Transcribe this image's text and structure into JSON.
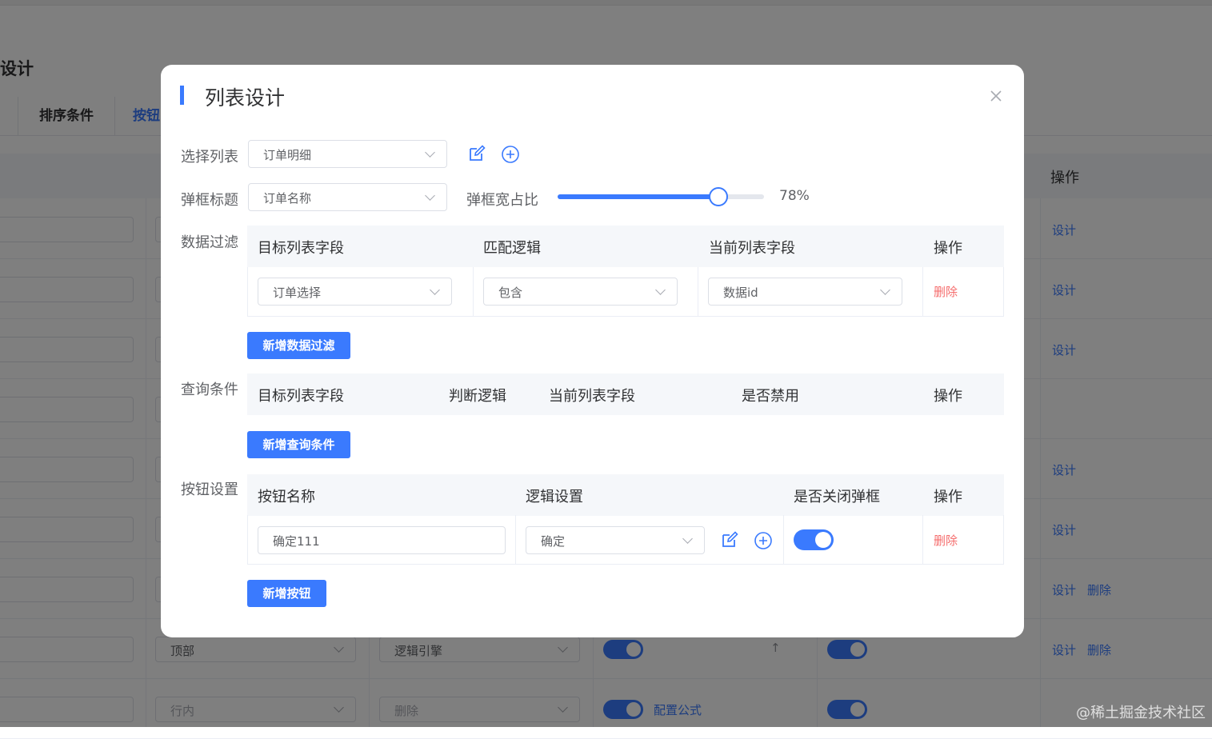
{
  "background": {
    "page_title": "设计",
    "tabs": [
      {
        "label": "排序条件"
      },
      {
        "label": "按钮"
      }
    ],
    "operation_header": "操作",
    "row_actions": [
      {
        "design": "设计",
        "delete": ""
      },
      {
        "design": "设计",
        "delete": ""
      },
      {
        "design": "设计",
        "delete": ""
      },
      {
        "design": "",
        "delete": ""
      },
      {
        "design": "设计",
        "delete": ""
      },
      {
        "design": "设计",
        "delete": ""
      },
      {
        "design": "设计",
        "delete": "删除"
      },
      {
        "design": "设计",
        "delete": "删除"
      }
    ],
    "row7": {
      "position": "顶部",
      "engine": "逻辑引擎",
      "arrow": "↑"
    },
    "row8": {
      "position": "行内",
      "engine": "删除",
      "formula": "配置公式"
    },
    "watermark": "@稀土掘金技术社区"
  },
  "dialog": {
    "title": "列表设计",
    "select_list": {
      "label": "选择列表",
      "value": "订单明细"
    },
    "dialog_title_field": {
      "label": "弹框标题",
      "value": "订单名称"
    },
    "width_ratio": {
      "label": "弹框宽占比",
      "value_text": "78%",
      "value": 0.78
    },
    "data_filter": {
      "label": "数据过滤",
      "headers": [
        "目标列表字段",
        "匹配逻辑",
        "当前列表字段",
        "操作"
      ],
      "rows": [
        {
          "target": "订单选择",
          "logic": "包含",
          "current": "数据id",
          "action": "删除"
        }
      ],
      "add_button": "新增数据过滤"
    },
    "query_conditions": {
      "label": "查询条件",
      "headers": [
        "目标列表字段",
        "判断逻辑",
        "当前列表字段",
        "是否禁用",
        "操作"
      ],
      "add_button": "新增查询条件"
    },
    "button_settings": {
      "label": "按钮设置",
      "headers": [
        "按钮名称",
        "逻辑设置",
        "是否关闭弹框",
        "操作"
      ],
      "rows": [
        {
          "name": "确定111",
          "logic": "确定",
          "close_dialog": true,
          "action": "删除"
        }
      ],
      "add_button": "新增按钮"
    }
  },
  "colors": {
    "primary": "#3a7afe",
    "danger": "#f56c6c",
    "header_bg": "#f5f7fa"
  }
}
